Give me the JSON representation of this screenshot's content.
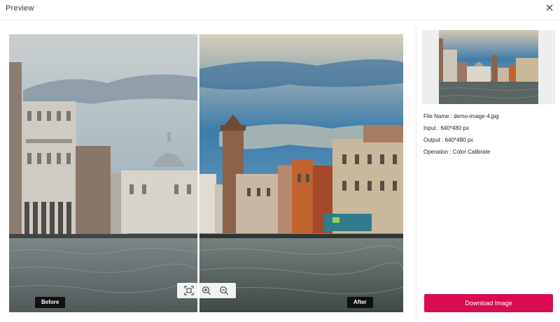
{
  "dialog": {
    "title": "Preview",
    "close_icon": "close-icon"
  },
  "viewer": {
    "before_label": "Before",
    "after_label": "After",
    "split_position": 0.48,
    "controls": [
      {
        "name": "fit-screen-icon"
      },
      {
        "name": "zoom-in-icon"
      },
      {
        "name": "zoom-out-icon"
      }
    ]
  },
  "details": {
    "file_name": "File Name : demo-image-4.jpg",
    "input": "Input : 640*480 px",
    "output": "Output : 640*480 px",
    "operation": "Operation : Color Calibrate"
  },
  "download_button": "Download Image",
  "colors": {
    "accent": "#d80c4f",
    "before_sky": "#aebdc4",
    "after_sky": "#3f7fae"
  }
}
